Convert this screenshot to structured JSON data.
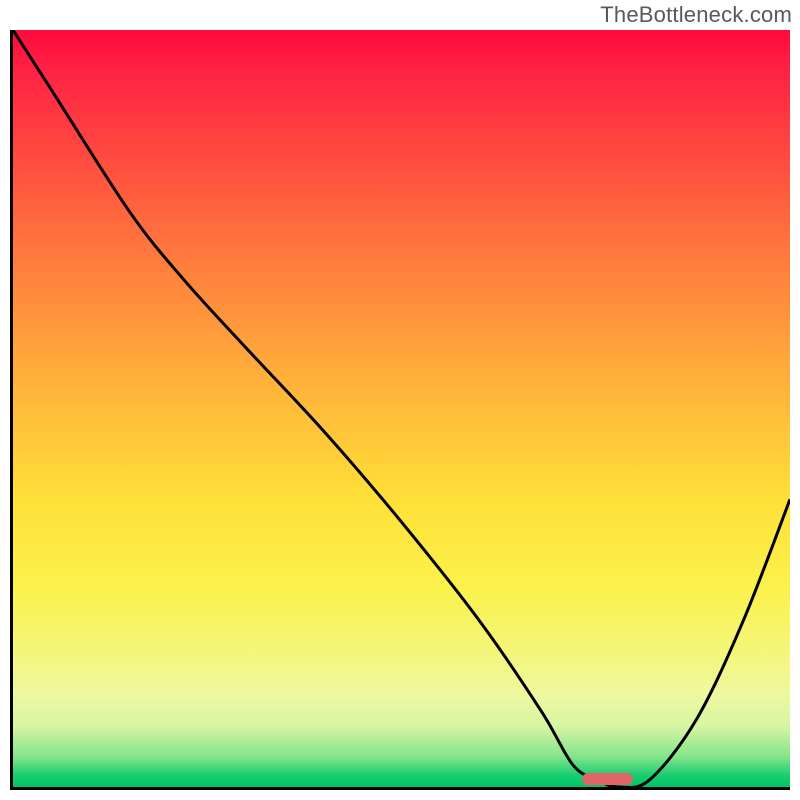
{
  "watermark": "TheBottleneck.com",
  "chart_data": {
    "type": "line",
    "title": "",
    "xlabel": "",
    "ylabel": "",
    "xlim": [
      0,
      100
    ],
    "ylim": [
      0,
      100
    ],
    "grid": false,
    "series": [
      {
        "name": "bottleneck-curve",
        "x": [
          0,
          5,
          15,
          22,
          30,
          40,
          50,
          60,
          68,
          72,
          75,
          78,
          82,
          88,
          94,
          100
        ],
        "values": [
          100,
          92,
          76,
          67,
          58,
          47,
          35,
          22,
          10,
          3,
          1,
          0,
          1,
          9,
          22,
          38
        ]
      }
    ],
    "marker": {
      "name": "optimal-range",
      "x_center": 76.5,
      "width": 6.5,
      "y": 0
    },
    "background": "rainbow-gradient-red-to-green"
  }
}
